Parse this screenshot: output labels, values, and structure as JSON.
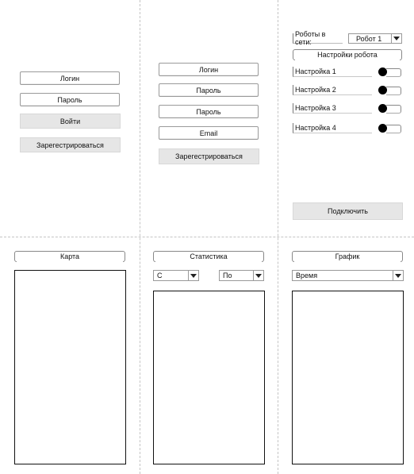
{
  "login_screen": {
    "login_placeholder": "Логин",
    "password_placeholder": "Пароль",
    "login_button": "Войти",
    "register_button": "Зарегестрироваться"
  },
  "register_screen": {
    "login_placeholder": "Логин",
    "password_placeholder": "Пароль",
    "password_confirm_placeholder": "Пароль",
    "email_placeholder": "Email",
    "register_button": "Зарегестрироваться"
  },
  "robot_screen": {
    "robots_online_label": "Роботы в сети:",
    "robot_select_value": "Робот 1",
    "settings_header": "Настройки робота",
    "settings": [
      {
        "label": "Настройка 1",
        "enabled": true
      },
      {
        "label": "Настройка 2",
        "enabled": true
      },
      {
        "label": "Настройка 3",
        "enabled": true
      },
      {
        "label": "Настройка 4",
        "enabled": true
      }
    ],
    "connect_button": "Подключить"
  },
  "map_screen": {
    "title": "Карта"
  },
  "stats_screen": {
    "title": "Статистика",
    "from_select_value": "С",
    "to_select_value": "По"
  },
  "graph_screen": {
    "title": "График",
    "time_select_value": "Время"
  },
  "icons": {
    "dropdown": "chevron-down-icon",
    "toggle": "toggle-switch-icon"
  }
}
